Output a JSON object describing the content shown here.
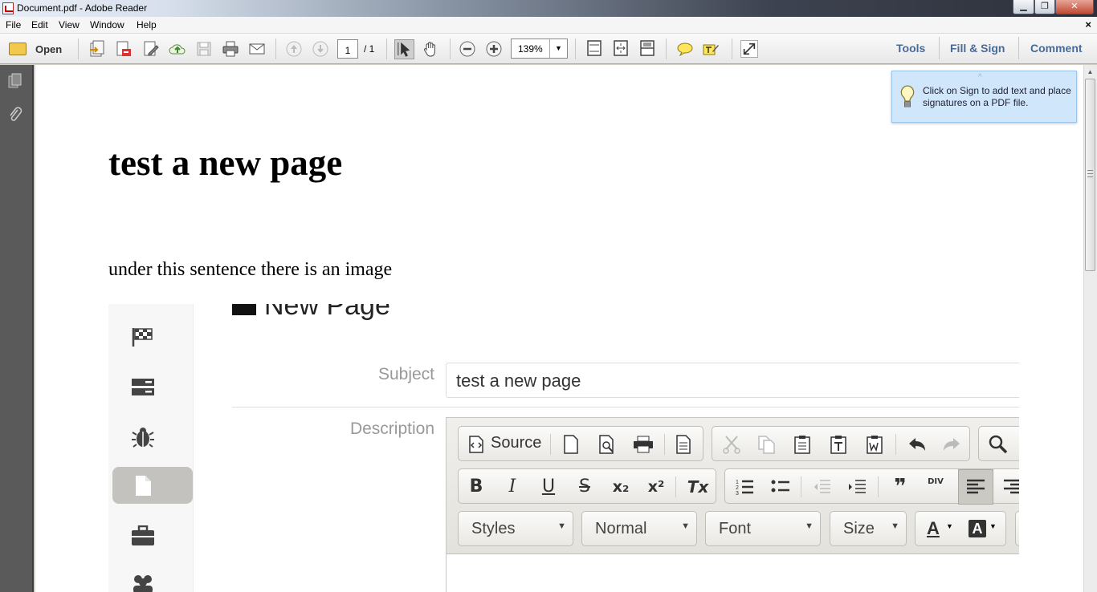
{
  "window": {
    "title": "Document.pdf - Adobe Reader",
    "controls": {
      "minimize": "▁",
      "maximize": "❐",
      "close": "✕"
    }
  },
  "menu": {
    "items": [
      "File",
      "Edit",
      "View",
      "Window",
      "Help"
    ],
    "close_glyph": "×"
  },
  "toolbar": {
    "open_label": "Open",
    "page_current": "1",
    "page_total": "/ 1",
    "zoom": "139%",
    "zoom_arrow": "▼",
    "tools": "Tools",
    "fill_sign": "Fill & Sign",
    "comment": "Comment"
  },
  "tooltip": {
    "arrow": "^",
    "text": "Click on Sign to add text and place signatures on a PDF file."
  },
  "document": {
    "title": "test a new page",
    "sentence": "under this sentence there is an image"
  },
  "embedded": {
    "heading": "New Page",
    "subject_label": "Subject",
    "subject_value": "test a new page",
    "description_label": "Description",
    "editor": {
      "source_label": "Source",
      "bold": "B",
      "italic": "I",
      "underline": "U",
      "strike": "S",
      "subscript": "x₂",
      "superscript": "x²",
      "remove_format": "Tx",
      "blockquote": "❞",
      "div": "DIV",
      "styles": "Styles",
      "format": "Normal",
      "font": "Font",
      "size": "Size",
      "text_color": "A",
      "bg_color": "A",
      "combo_arrow": "▼"
    }
  },
  "scrollbar": {
    "up_arrow": "▲"
  },
  "colors": {
    "toolbar_link": "#4a6a96",
    "tooltip_bg": "#cfe6fb",
    "nav_pane": "#5a5a5a"
  }
}
